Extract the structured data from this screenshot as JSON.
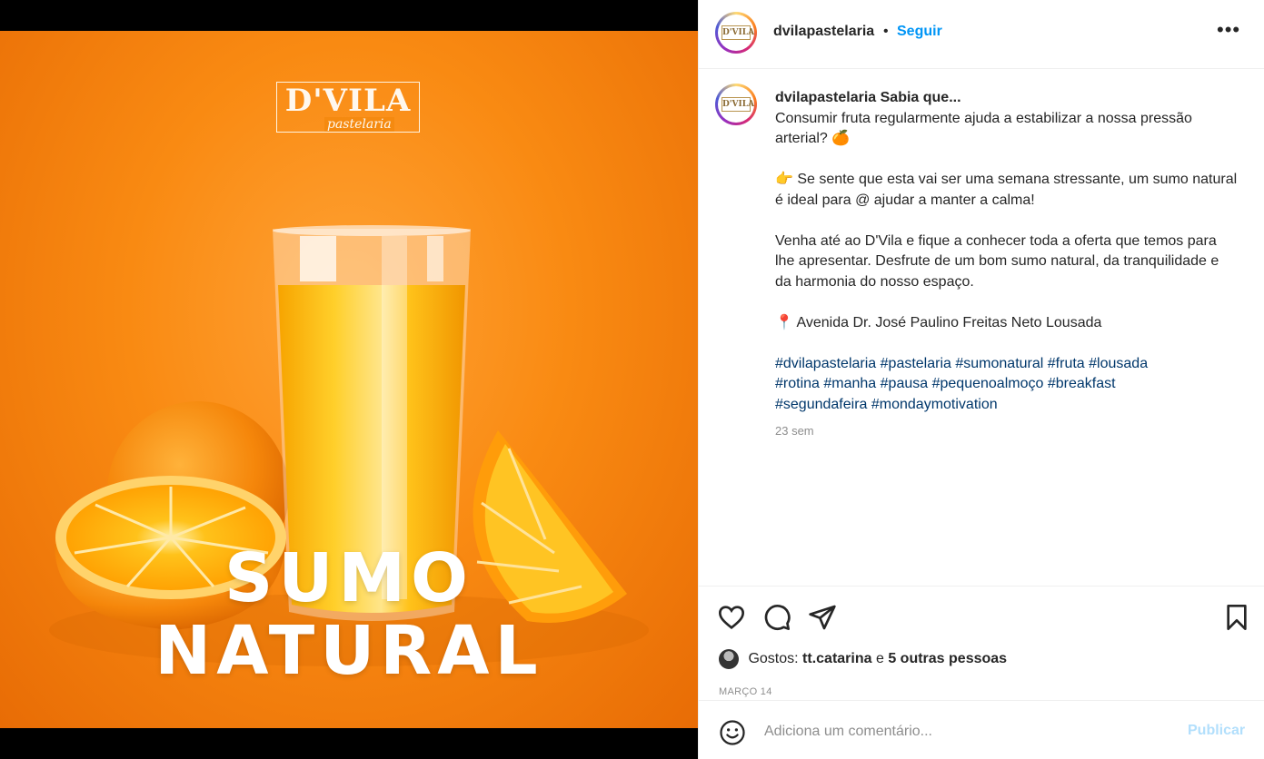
{
  "post_image": {
    "logo_main": "D'VILA",
    "logo_sub": "pastelaria",
    "headline_line1": "SUMO",
    "headline_line2": "NATURAL"
  },
  "header": {
    "username": "dvilapastelaria",
    "separator": "•",
    "follow_label": "Seguir",
    "more_label": "•••",
    "avatar_text": "D'VILA"
  },
  "caption": {
    "username": "dvilapastelaria",
    "title": "Sabia que...",
    "line1": "Consumir fruta regularmente ajuda a estabilizar a nossa pressão arterial? 🍊",
    "line2": "👉 Se sente que esta vai ser uma semana stressante, um sumo natural é ideal para @ ajudar a manter a calma!",
    "line3": "Venha até ao D'Vila e fique a conhecer toda a oferta que temos para lhe apresentar. Desfrute de um bom sumo natural, da tranquilidade e da harmonia do nosso espaço.",
    "line4": "📍 Avenida Dr. José Paulino Freitas Neto Lousada",
    "hashtags": [
      "#dvilapastelaria",
      "#pastelaria",
      "#sumonatural",
      "#fruta",
      "#lousada",
      "#rotina",
      "#manha",
      "#pausa",
      "#pequenoalmoço",
      "#breakfast",
      "#segundafeira",
      "#mondaymotivation"
    ],
    "time_ago": "23 sem"
  },
  "actions": {
    "like_icon": "heart-icon",
    "comment_icon": "comment-bubble-icon",
    "share_icon": "paper-plane-icon",
    "save_icon": "bookmark-icon"
  },
  "likes": {
    "prefix": "Gostos:",
    "user": "tt.catarina",
    "conjunction": "e",
    "others": "5 outras pessoas"
  },
  "date": "MARÇO 14",
  "comment_box": {
    "placeholder": "Adiciona um comentário...",
    "post_label": "Publicar"
  }
}
